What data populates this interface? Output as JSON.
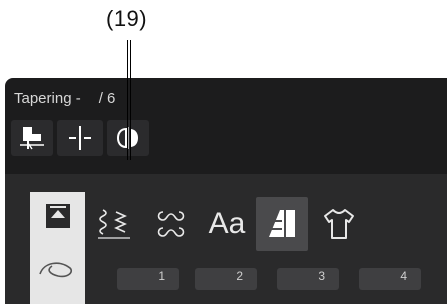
{
  "callout": {
    "label": "(19)"
  },
  "header": {
    "title": "Tapering -",
    "total": "/ 6"
  },
  "toolbar": {
    "buttons": [
      {
        "icon": "tapering-start-icon"
      },
      {
        "icon": "needle-position-icon"
      },
      {
        "icon": "mirror-icon"
      }
    ]
  },
  "tabs": [
    {
      "icon": "utility-stitch-icon",
      "active": true
    },
    {
      "icon": "decorative-stitch-icon"
    },
    {
      "icon": "quilt-stitch-icon"
    },
    {
      "label": "Aa",
      "icon": "alphabet-icon"
    },
    {
      "icon": "tapering-category-icon",
      "selected": true
    },
    {
      "icon": "garment-icon"
    }
  ],
  "subbuttons": [
    {
      "number": "1"
    },
    {
      "number": "2"
    },
    {
      "number": "3"
    },
    {
      "number": "4"
    }
  ],
  "colors": {
    "panel": "#1c1c1d",
    "tabbar": "#2a2a2b",
    "active": "#e6e6e6"
  }
}
